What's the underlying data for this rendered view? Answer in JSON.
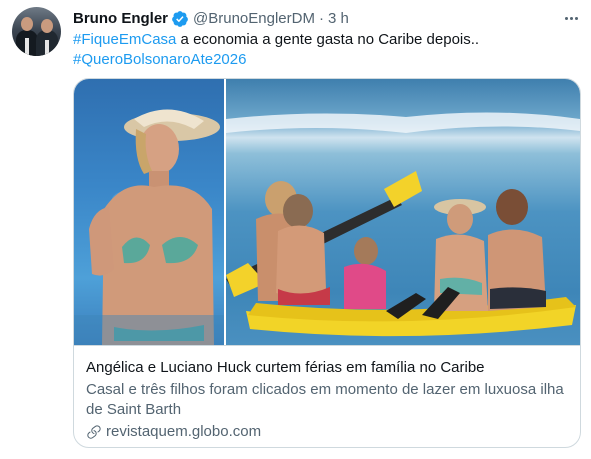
{
  "tweet": {
    "author_name": "Bruno Engler",
    "handle": "@BrunoEnglerDM",
    "separator": "·",
    "time": "3 h",
    "text_parts": {
      "hashtag1": "#FiqueEmCasa",
      "body": " a economia a gente gasta no Caribe depois..",
      "hashtag2": "#QueroBolsonaroAte2026"
    }
  },
  "card": {
    "title": "Angélica e Luciano Huck curtem férias em família no Caribe",
    "description": "Casal e três filhos foram clicados em momento de lazer em luxuosa ilha de Saint Barth",
    "domain": "revistaquem.globo.com"
  },
  "colors": {
    "accent": "#1d9bf0",
    "secondary_text": "#536471",
    "border": "#cfd9de"
  },
  "icons": {
    "verified": "verified-badge-icon",
    "more": "more-options-icon",
    "link": "link-icon"
  }
}
